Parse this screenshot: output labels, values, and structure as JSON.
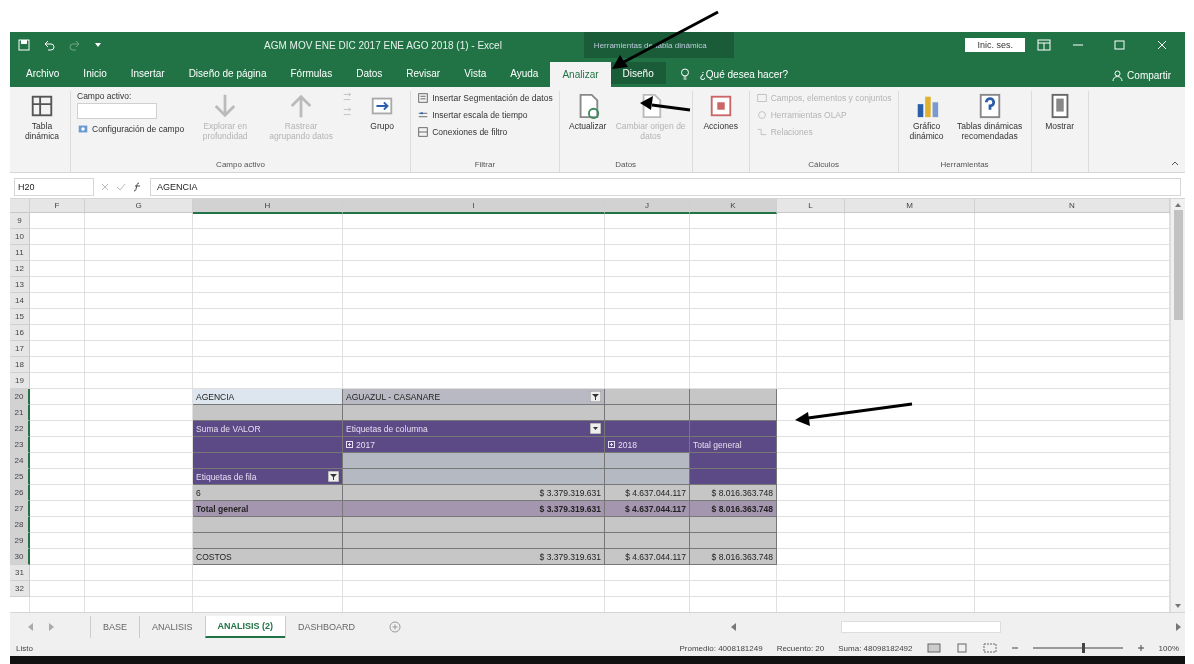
{
  "window": {
    "title": "AGM MOV ENE DIC  2017 ENE AGO 2018 (1)  -  Excel",
    "context_title": "Herramientas de tabla dinámica",
    "sign_in": "Inic. ses."
  },
  "ribbon_tabs": [
    {
      "label": "Archivo",
      "selected": false,
      "kind": "normal"
    },
    {
      "label": "Inicio",
      "selected": false,
      "kind": "normal"
    },
    {
      "label": "Insertar",
      "selected": false,
      "kind": "normal"
    },
    {
      "label": "Diseño de página",
      "selected": false,
      "kind": "normal"
    },
    {
      "label": "Fórmulas",
      "selected": false,
      "kind": "normal"
    },
    {
      "label": "Datos",
      "selected": false,
      "kind": "normal"
    },
    {
      "label": "Revisar",
      "selected": false,
      "kind": "normal"
    },
    {
      "label": "Vista",
      "selected": false,
      "kind": "normal"
    },
    {
      "label": "Ayuda",
      "selected": false,
      "kind": "normal"
    },
    {
      "label": "Analizar",
      "selected": true,
      "kind": "context"
    },
    {
      "label": "Diseño",
      "selected": false,
      "kind": "context"
    }
  ],
  "tell_me": "¿Qué desea hacer?",
  "share": "Compartir",
  "ribbon_groups": [
    {
      "items": [
        {
          "kind": "large",
          "label": "Tabla dinámica",
          "disabled": false
        }
      ]
    },
    {
      "label": "Campo activo",
      "items": [
        {
          "kind": "field",
          "label": "Campo activo:"
        },
        {
          "kind": "small",
          "label": "Configuración de campo",
          "disabled": false
        },
        {
          "kind": "large",
          "label": "Explorar en profundidad",
          "disabled": true
        },
        {
          "kind": "large",
          "label": "Rastrear agrupando datos",
          "disabled": true
        },
        {
          "kind": "mini",
          "disabled": true
        },
        {
          "kind": "large",
          "label": "Grupo",
          "disabled": false
        }
      ]
    },
    {
      "label": "Filtrar",
      "items": [
        {
          "kind": "small",
          "label": "Insertar Segmentación de datos",
          "disabled": false
        },
        {
          "kind": "small",
          "label": "Insertar escala de tiempo",
          "disabled": false
        },
        {
          "kind": "small",
          "label": "Conexiones de filtro",
          "disabled": false
        }
      ]
    },
    {
      "label": "Datos",
      "items": [
        {
          "kind": "large",
          "label": "Actualizar",
          "disabled": false
        },
        {
          "kind": "large",
          "label": "Cambiar origen de datos",
          "disabled": true
        }
      ]
    },
    {
      "items": [
        {
          "kind": "large",
          "label": "Acciones",
          "disabled": false
        }
      ]
    },
    {
      "label": "Cálculos",
      "items": [
        {
          "kind": "small",
          "label": "Campos, elementos y conjuntos",
          "disabled": true
        },
        {
          "kind": "small",
          "label": "Herramientas OLAP",
          "disabled": true
        },
        {
          "kind": "small",
          "label": "Relaciones",
          "disabled": true
        }
      ]
    },
    {
      "label": "Herramientas",
      "items": [
        {
          "kind": "large",
          "label": "Gráfico dinámico",
          "disabled": false
        },
        {
          "kind": "large",
          "label": "Tablas dinámicas recomendadas",
          "disabled": false
        }
      ]
    },
    {
      "items": [
        {
          "kind": "large",
          "label": "Mostrar",
          "disabled": false
        }
      ]
    }
  ],
  "formula_bar": {
    "name_box": "H20",
    "value": "AGENCIA"
  },
  "columns": [
    {
      "label": "F",
      "selected": false
    },
    {
      "label": "G",
      "selected": false
    },
    {
      "label": "H",
      "selected": true
    },
    {
      "label": "I",
      "selected": true
    },
    {
      "label": "J",
      "selected": true
    },
    {
      "label": "K",
      "selected": true
    },
    {
      "label": "L",
      "selected": false
    },
    {
      "label": "M",
      "selected": false
    },
    {
      "label": "N",
      "selected": false
    }
  ],
  "rows": [
    {
      "number": "9",
      "selected": false,
      "kind": "blank"
    },
    {
      "number": "10",
      "selected": false,
      "kind": "blank"
    },
    {
      "number": "11",
      "selected": false,
      "kind": "blank"
    },
    {
      "number": "12",
      "selected": false,
      "kind": "blank"
    },
    {
      "number": "13",
      "selected": false,
      "kind": "blank"
    },
    {
      "number": "14",
      "selected": false,
      "kind": "blank"
    },
    {
      "number": "15",
      "selected": false,
      "kind": "blank"
    },
    {
      "number": "16",
      "selected": false,
      "kind": "blank"
    },
    {
      "number": "17",
      "selected": false,
      "kind": "blank"
    },
    {
      "number": "18",
      "selected": false,
      "kind": "blank"
    },
    {
      "number": "19",
      "selected": false,
      "kind": "blank"
    },
    {
      "number": "20",
      "selected": true,
      "kind": "report-filter",
      "cells": [
        "AGENCIA",
        "AGUAZUL - CASANARE"
      ]
    },
    {
      "number": "21",
      "selected": true,
      "kind": "gap"
    },
    {
      "number": "22",
      "selected": true,
      "kind": "pivot-head",
      "cells": [
        "Suma de VALOR",
        "Etiquetas de columna"
      ]
    },
    {
      "number": "23",
      "selected": true,
      "kind": "years",
      "cells": [
        "2017",
        "2018",
        "Total general"
      ]
    },
    {
      "number": "24",
      "selected": true,
      "kind": "head-blank"
    },
    {
      "number": "25",
      "selected": true,
      "kind": "row-labels",
      "cells": [
        "Etiquetas de fila"
      ]
    },
    {
      "number": "26",
      "selected": true,
      "kind": "values",
      "cells": [
        "6",
        "$ 3.379.319.631",
        "$ 4.637.044.117",
        "$ 8.016.363.748"
      ]
    },
    {
      "number": "27",
      "selected": true,
      "kind": "total",
      "cells": [
        "Total general",
        "$ 3.379.319.631",
        "$ 4.637.044.117",
        "$ 8.016.363.748"
      ]
    },
    {
      "number": "28",
      "selected": true,
      "kind": "gap"
    },
    {
      "number": "29",
      "selected": true,
      "kind": "gap"
    },
    {
      "number": "30",
      "selected": true,
      "kind": "values",
      "cells": [
        "COSTOS",
        "$ 3.379.319.631",
        "$ 4.637.044.117",
        "$ 8.016.363.748"
      ]
    },
    {
      "number": "31",
      "selected": false,
      "kind": "blank"
    },
    {
      "number": "32",
      "selected": false,
      "kind": "blank"
    }
  ],
  "sheet_tabs": [
    {
      "label": "BASE",
      "selected": false
    },
    {
      "label": "ANALISIS",
      "selected": false
    },
    {
      "label": "ANALISIS (2)",
      "selected": true
    },
    {
      "label": "DASHBOARD",
      "selected": false
    }
  ],
  "status_bar": {
    "state": "Listo",
    "stats": [
      "Promedio: 4008181249",
      "Recuento: 20",
      "Suma: 48098182492"
    ],
    "zoom": {
      "level": 0.55,
      "reading": "100%"
    }
  }
}
